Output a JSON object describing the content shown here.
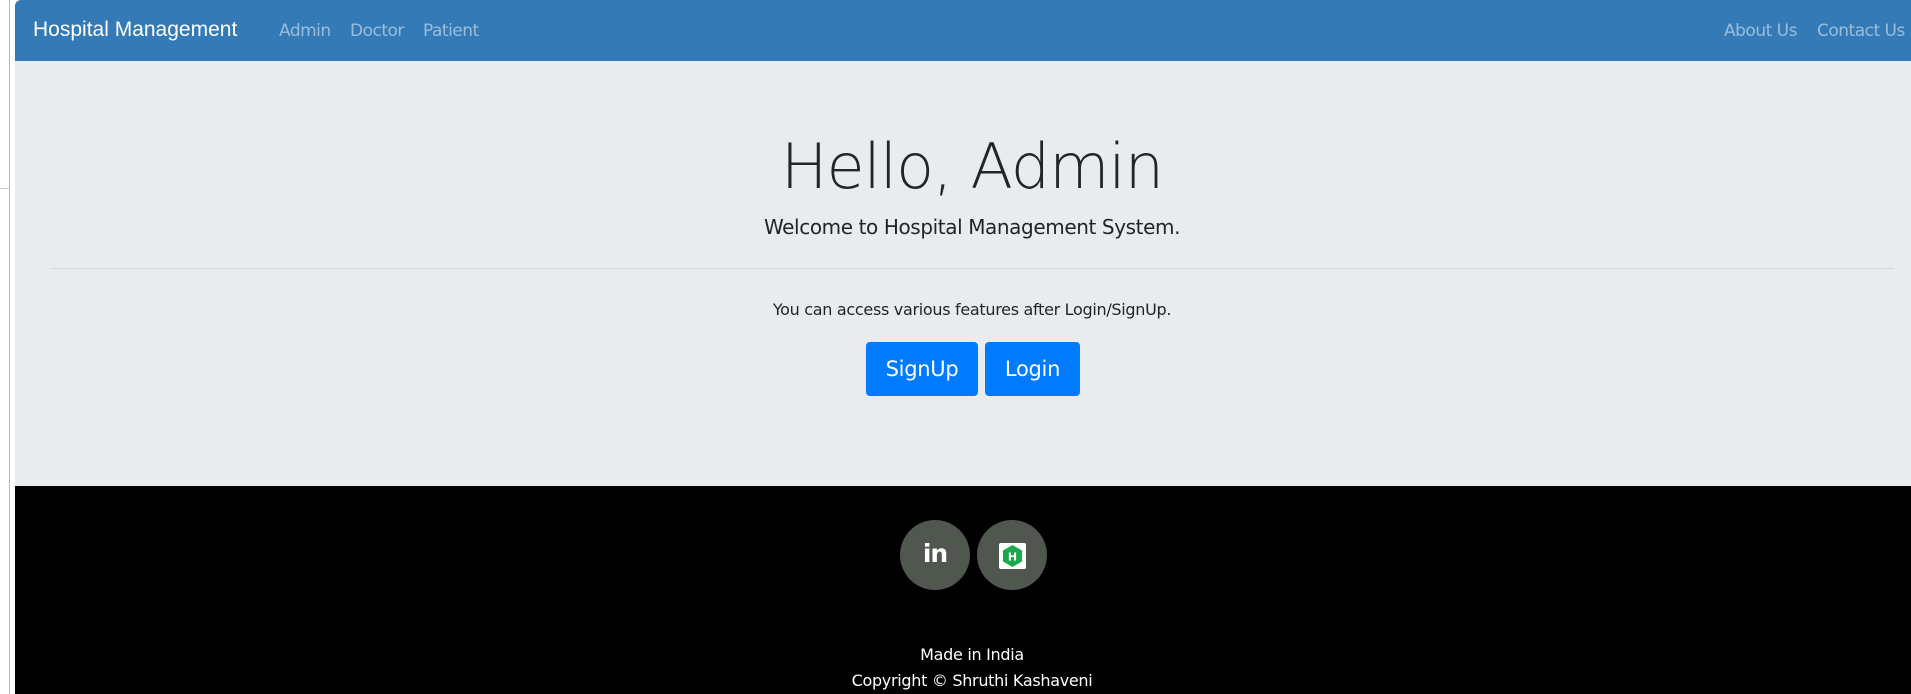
{
  "navbar": {
    "brand": "Hospital Management",
    "left_links": [
      "Admin",
      "Doctor",
      "Patient"
    ],
    "right_links": [
      "About Us",
      "Contact Us"
    ],
    "background": "#337ab7"
  },
  "hero": {
    "title": "Hello, Admin",
    "lead": "Welcome to Hospital Management System.",
    "text": "You can access various features after Login/SignUp.",
    "signup_label": "SignUp",
    "login_label": "Login",
    "button_color": "#007bff",
    "background": "#e9ecef"
  },
  "footer": {
    "social": [
      {
        "icon": "linkedin-icon",
        "label": "in"
      },
      {
        "icon": "hackerrank-icon",
        "label": "H"
      }
    ],
    "made_in": "Made in India",
    "copyright": "Copyright © Shruthi Kashaveni",
    "background": "#000000"
  }
}
